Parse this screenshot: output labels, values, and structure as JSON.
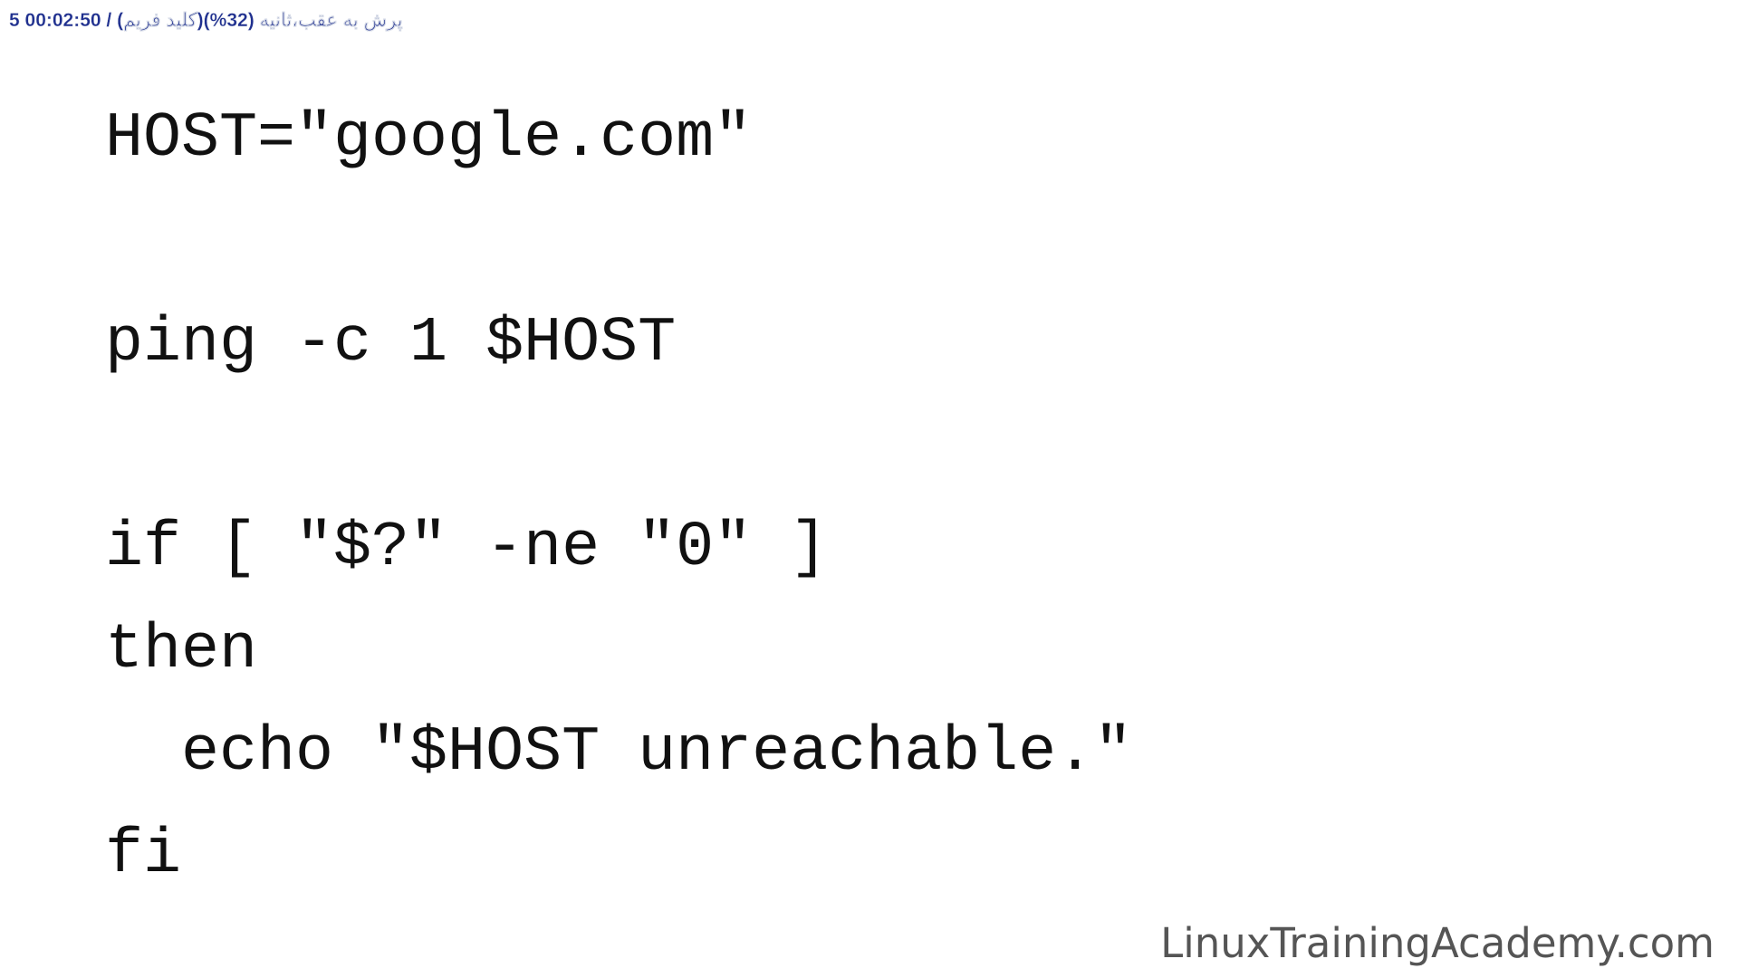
{
  "player_overlay": {
    "status_text": "5 00:02:50 / (کلید فریم)پرش به عقب،ثانیه (32%)"
  },
  "code_lines": [
    "HOST=\"google.com\"",
    "ping -c 1 $HOST",
    "if [ \"$?\" -ne \"0\" ]",
    "then",
    "  echo \"$HOST unreachable.\"",
    "fi"
  ],
  "watermark": "LinuxTrainingAcademy.com"
}
